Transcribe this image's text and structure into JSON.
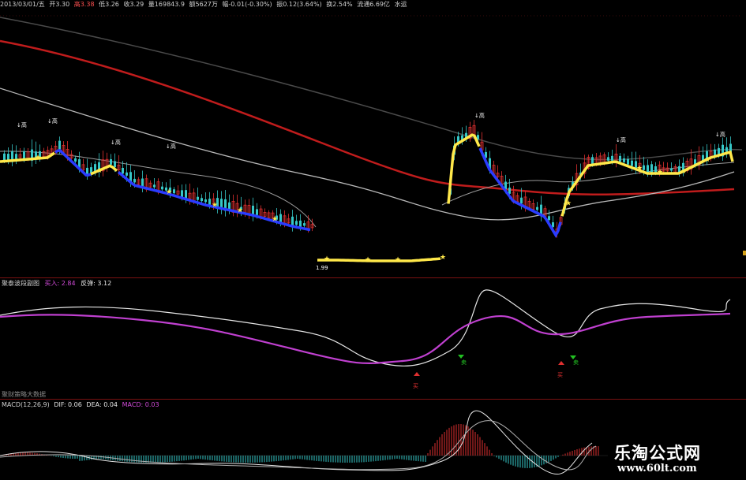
{
  "status_bar": {
    "date": "2013/03/01/五",
    "open": "开3.30",
    "high": "高3.38",
    "low": "低3.26",
    "close": "收3.29",
    "volume": "量169843.9",
    "amount": "额5627万",
    "change": "幅-0.01(-0.30%)",
    "amplitude": "振0.12(3.64%)",
    "turnover": "换2.54%",
    "float_cap": "流通6.69亿",
    "note": "水运"
  },
  "main_chart": {
    "low_marker": "1.99",
    "peak_markers": [
      "↓高",
      "↓高",
      "↓高",
      "↓高",
      "↓高",
      "↓高",
      "↓高"
    ]
  },
  "indicator_panel": {
    "name": "聚泰波段副图",
    "buy_label": "买入: 2.84",
    "rebound_label": "反弹: 3.12",
    "signal_buy": "买",
    "signal_sell": "卖",
    "bottom_label": "聚财策略大数据"
  },
  "macd_panel": {
    "name": "MACD(12,26,9)",
    "dif": "DIF: 0.06",
    "dea": "DEA: 0.04",
    "macd": "MACD: 0.03"
  },
  "watermark": {
    "title": "乐淘公式网",
    "url": "www.60lt.com"
  },
  "colors": {
    "up": "#e03030",
    "down": "#36c7c7",
    "ma_long": "#c01c1c",
    "ma_gray": "#b8b8b8",
    "band_yellow": "#ffe84a",
    "band_blue": "#2a3cff",
    "indicator_purple": "#c040d0",
    "indicator_white": "#e6e6e6",
    "separator": "#7a1111"
  }
}
